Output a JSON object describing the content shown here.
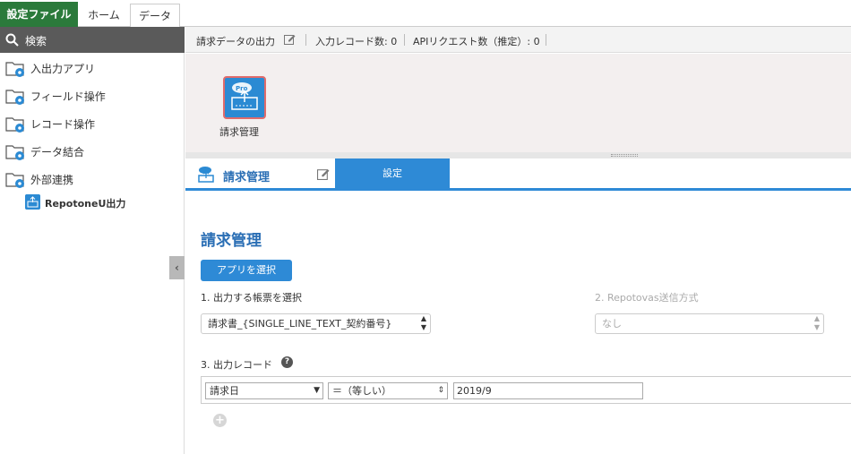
{
  "tabs": {
    "settings_file": "設定ファイル",
    "home": "ホーム",
    "data": "データ"
  },
  "sidebar": {
    "search_label": "検索",
    "items": [
      {
        "label": "入出力アプリ"
      },
      {
        "label": "フィールド操作"
      },
      {
        "label": "レコード操作"
      },
      {
        "label": "データ結合"
      },
      {
        "label": "外部連携"
      }
    ],
    "sub_item": {
      "label": "RepotoneU出力"
    }
  },
  "header": {
    "title": "請求データの出力",
    "record_count": "入力レコード数: 0",
    "api_count": "APIリクエスト数（推定）: 0"
  },
  "canvas": {
    "node_label": "請求管理",
    "node_badge": "Pro"
  },
  "panel": {
    "title": "請求管理",
    "settings_tab": "設定",
    "body_title": "請求管理",
    "select_app_button": "アプリを選択",
    "step1_label": "1. 出力する帳票を選択",
    "step1_value": "請求書_{SINGLE_LINE_TEXT_契約番号}",
    "step2_label": "2. Repotovas送信方式",
    "step2_value": "なし",
    "step3_label": "3. 出力レコード",
    "help": "?",
    "condition": {
      "field": "請求日",
      "operator": "＝（等しい）",
      "value": "2019/9"
    }
  },
  "colors": {
    "accent": "#2e8ad6",
    "brand_green": "#2b7a3b",
    "node_border": "#e06b6b"
  }
}
